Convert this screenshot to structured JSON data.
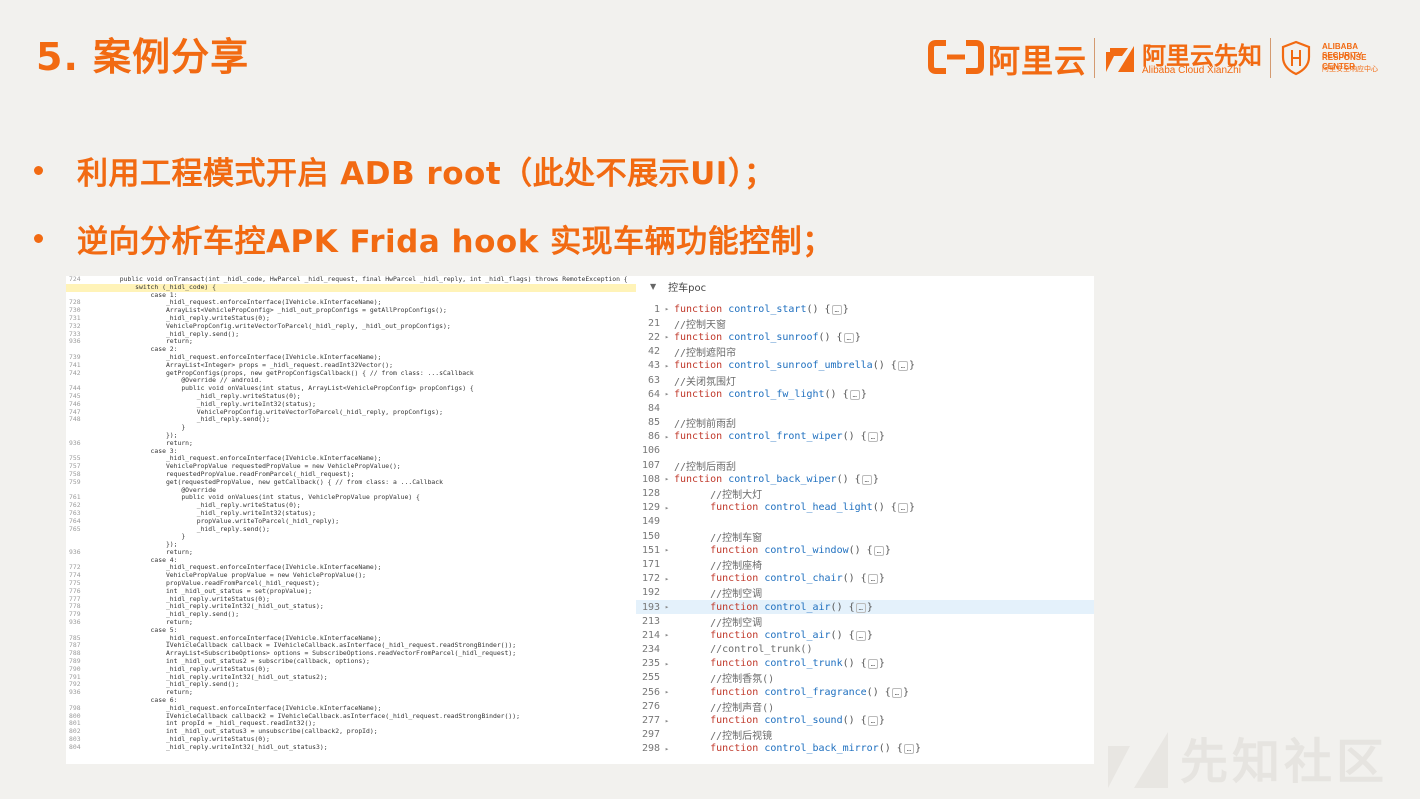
{
  "slide": {
    "title": "5. 案例分享",
    "bullets": [
      "利用工程模式开启 ADB root（此处不展示UI）；",
      "逆向分析车控APK Frida hook 实现车辆功能控制；"
    ]
  },
  "logo": {
    "aliyun": "阿里云",
    "xianzhi_main": "阿里云先知",
    "xianzhi_sub": "Alibaba Cloud XianZhi",
    "asrc_line1": "ALIBABA SECURITY",
    "asrc_line2": "RESPONSE CENTER",
    "asrc_line3": "阿里安全响应中心",
    "brand_color": "#f26a12"
  },
  "left_code": {
    "lines": [
      {
        "n": "724",
        "t": "        public void onTransact(int _hidl_code, HwParcel _hidl_request, final HwParcel _hidl_reply, int _hidl_flags) throws RemoteException {"
      },
      {
        "n": "",
        "t": "            switch (_hidl_code) {",
        "hl": true
      },
      {
        "n": "",
        "t": "                case 1:"
      },
      {
        "n": "728",
        "t": "                    _hidl_request.enforceInterface(IVehicle.kInterfaceName);"
      },
      {
        "n": "730",
        "t": "                    ArrayList<VehiclePropConfig> _hidl_out_propConfigs = getAllPropConfigs();"
      },
      {
        "n": "731",
        "t": "                    _hidl_reply.writeStatus(0);"
      },
      {
        "n": "732",
        "t": "                    VehiclePropConfig.writeVectorToParcel(_hidl_reply, _hidl_out_propConfigs);"
      },
      {
        "n": "733",
        "t": "                    _hidl_reply.send();"
      },
      {
        "n": "936",
        "t": "                    return;"
      },
      {
        "n": "",
        "t": "                case 2:"
      },
      {
        "n": "739",
        "t": "                    _hidl_request.enforceInterface(IVehicle.kInterfaceName);"
      },
      {
        "n": "741",
        "t": "                    ArrayList<Integer> props = _hidl_request.readInt32Vector();"
      },
      {
        "n": "742",
        "t": "                    getPropConfigs(props, new getPropConfigsCallback() { // from class: ...sCallback"
      },
      {
        "n": "",
        "t": "                        @Override // android."
      },
      {
        "n": "744",
        "t": "                        public void onValues(int status, ArrayList<VehiclePropConfig> propConfigs) {"
      },
      {
        "n": "745",
        "t": "                            _hidl_reply.writeStatus(0);"
      },
      {
        "n": "746",
        "t": "                            _hidl_reply.writeInt32(status);"
      },
      {
        "n": "747",
        "t": "                            VehiclePropConfig.writeVectorToParcel(_hidl_reply, propConfigs);"
      },
      {
        "n": "748",
        "t": "                            _hidl_reply.send();"
      },
      {
        "n": "",
        "t": "                        }"
      },
      {
        "n": "",
        "t": "                    });"
      },
      {
        "n": "936",
        "t": "                    return;"
      },
      {
        "n": "",
        "t": "                case 3:"
      },
      {
        "n": "755",
        "t": "                    _hidl_request.enforceInterface(IVehicle.kInterfaceName);"
      },
      {
        "n": "757",
        "t": "                    VehiclePropValue requestedPropValue = new VehiclePropValue();"
      },
      {
        "n": "758",
        "t": "                    requestedPropValue.readFromParcel(_hidl_request);"
      },
      {
        "n": "759",
        "t": "                    get(requestedPropValue, new getCallback() { // from class: a ...Callback"
      },
      {
        "n": "",
        "t": "                        @Override"
      },
      {
        "n": "761",
        "t": "                        public void onValues(int status, VehiclePropValue propValue) {"
      },
      {
        "n": "762",
        "t": "                            _hidl_reply.writeStatus(0);"
      },
      {
        "n": "763",
        "t": "                            _hidl_reply.writeInt32(status);"
      },
      {
        "n": "764",
        "t": "                            propValue.writeToParcel(_hidl_reply);"
      },
      {
        "n": "765",
        "t": "                            _hidl_reply.send();"
      },
      {
        "n": "",
        "t": "                        }"
      },
      {
        "n": "",
        "t": "                    });"
      },
      {
        "n": "936",
        "t": "                    return;"
      },
      {
        "n": "",
        "t": "                case 4:"
      },
      {
        "n": "772",
        "t": "                    _hidl_request.enforceInterface(IVehicle.kInterfaceName);"
      },
      {
        "n": "774",
        "t": "                    VehiclePropValue propValue = new VehiclePropValue();"
      },
      {
        "n": "775",
        "t": "                    propValue.readFromParcel(_hidl_request);"
      },
      {
        "n": "776",
        "t": "                    int _hidl_out_status = set(propValue);"
      },
      {
        "n": "777",
        "t": "                    _hidl_reply.writeStatus(0);"
      },
      {
        "n": "778",
        "t": "                    _hidl_reply.writeInt32(_hidl_out_status);"
      },
      {
        "n": "779",
        "t": "                    _hidl_reply.send();"
      },
      {
        "n": "936",
        "t": "                    return;"
      },
      {
        "n": "",
        "t": "                case 5:"
      },
      {
        "n": "785",
        "t": "                    _hidl_request.enforceInterface(IVehicle.kInterfaceName);"
      },
      {
        "n": "787",
        "t": "                    IVehicleCallback callback = IVehicleCallback.asInterface(_hidl_request.readStrongBinder());"
      },
      {
        "n": "788",
        "t": "                    ArrayList<SubscribeOptions> options = SubscribeOptions.readVectorFromParcel(_hidl_request);"
      },
      {
        "n": "789",
        "t": "                    int _hidl_out_status2 = subscribe(callback, options);"
      },
      {
        "n": "790",
        "t": "                    _hidl_reply.writeStatus(0);"
      },
      {
        "n": "791",
        "t": "                    _hidl_reply.writeInt32(_hidl_out_status2);"
      },
      {
        "n": "792",
        "t": "                    _hidl_reply.send();"
      },
      {
        "n": "936",
        "t": "                    return;"
      },
      {
        "n": "",
        "t": "                case 6:"
      },
      {
        "n": "798",
        "t": "                    _hidl_request.enforceInterface(IVehicle.kInterfaceName);"
      },
      {
        "n": "800",
        "t": "                    IVehicleCallback callback2 = IVehicleCallback.asInterface(_hidl_request.readStrongBinder());"
      },
      {
        "n": "801",
        "t": "                    int propId = _hidl_request.readInt32();"
      },
      {
        "n": "802",
        "t": "                    int _hidl_out_status3 = unsubscribe(callback2, propId);"
      },
      {
        "n": "803",
        "t": "                    _hidl_reply.writeStatus(0);"
      },
      {
        "n": "804",
        "t": "                    _hidl_reply.writeInt32(_hidl_out_status3);"
      }
    ]
  },
  "right_code": {
    "header": "控车poc",
    "selected_row": 14,
    "lines": [
      {
        "n": "1",
        "fold": true,
        "kind": "fn",
        "name": "control_start"
      },
      {
        "n": "21",
        "fold": false,
        "kind": "cmt",
        "text": "//控制天窗"
      },
      {
        "n": "22",
        "fold": true,
        "kind": "fn",
        "name": "control_sunroof"
      },
      {
        "n": "42",
        "fold": false,
        "kind": "cmt",
        "text": "//控制遮阳帘"
      },
      {
        "n": "43",
        "fold": true,
        "kind": "fn",
        "name": "control_sunroof_umbrella"
      },
      {
        "n": "63",
        "fold": false,
        "kind": "cmt",
        "text": "//关闭氛围灯"
      },
      {
        "n": "64",
        "fold": true,
        "kind": "fn",
        "name": "control_fw_light"
      },
      {
        "n": "84",
        "fold": false,
        "kind": "blank"
      },
      {
        "n": "85",
        "fold": false,
        "kind": "cmt",
        "text": "//控制前雨刮"
      },
      {
        "n": "86",
        "fold": true,
        "kind": "fn",
        "name": "control_front_wiper"
      },
      {
        "n": "106",
        "fold": false,
        "kind": "blank"
      },
      {
        "n": "107",
        "fold": false,
        "kind": "cmt",
        "text": "//控制后雨刮"
      },
      {
        "n": "108",
        "fold": true,
        "kind": "fn",
        "name": "control_back_wiper"
      },
      {
        "n": "128",
        "fold": false,
        "kind": "cmt",
        "indent": true,
        "text": "//控制大灯"
      },
      {
        "n": "129",
        "fold": true,
        "kind": "fn",
        "indent": true,
        "name": "control_head_light"
      },
      {
        "n": "149",
        "fold": false,
        "kind": "blank"
      },
      {
        "n": "150",
        "fold": false,
        "kind": "cmt",
        "indent": true,
        "text": "//控制车窗"
      },
      {
        "n": "151",
        "fold": true,
        "kind": "fn",
        "indent": true,
        "name": "control_window"
      },
      {
        "n": "171",
        "fold": false,
        "kind": "cmt",
        "indent": true,
        "text": "//控制座椅"
      },
      {
        "n": "172",
        "fold": true,
        "kind": "fn",
        "indent": true,
        "name": "control_chair"
      },
      {
        "n": "192",
        "fold": false,
        "kind": "cmt",
        "indent": true,
        "text": "//控制空调"
      },
      {
        "n": "193",
        "fold": true,
        "kind": "fn",
        "indent": true,
        "name": "control_air",
        "sel": true
      },
      {
        "n": "213",
        "fold": false,
        "kind": "cmt",
        "indent": true,
        "text": "//控制空调"
      },
      {
        "n": "214",
        "fold": true,
        "kind": "fn",
        "indent": true,
        "name": "control_air"
      },
      {
        "n": "234",
        "fold": false,
        "kind": "cmt",
        "indent": true,
        "text": "//control_trunk()"
      },
      {
        "n": "235",
        "fold": true,
        "kind": "fn",
        "indent": true,
        "name": "control_trunk"
      },
      {
        "n": "255",
        "fold": false,
        "kind": "cmt",
        "indent": true,
        "text": "//控制香氛()"
      },
      {
        "n": "256",
        "fold": true,
        "kind": "fn",
        "indent": true,
        "name": "control_fragrance"
      },
      {
        "n": "276",
        "fold": false,
        "kind": "cmt",
        "indent": true,
        "text": "//控制声音()"
      },
      {
        "n": "277",
        "fold": true,
        "kind": "fn",
        "indent": true,
        "name": "control_sound"
      },
      {
        "n": "297",
        "fold": false,
        "kind": "cmt",
        "indent": true,
        "text": "//控制后视镜"
      },
      {
        "n": "298",
        "fold": true,
        "kind": "fn",
        "indent": true,
        "name": "control_back_mirror"
      }
    ],
    "keyword": "function",
    "collapsed_body": "{…}"
  },
  "watermark": "先知社区"
}
